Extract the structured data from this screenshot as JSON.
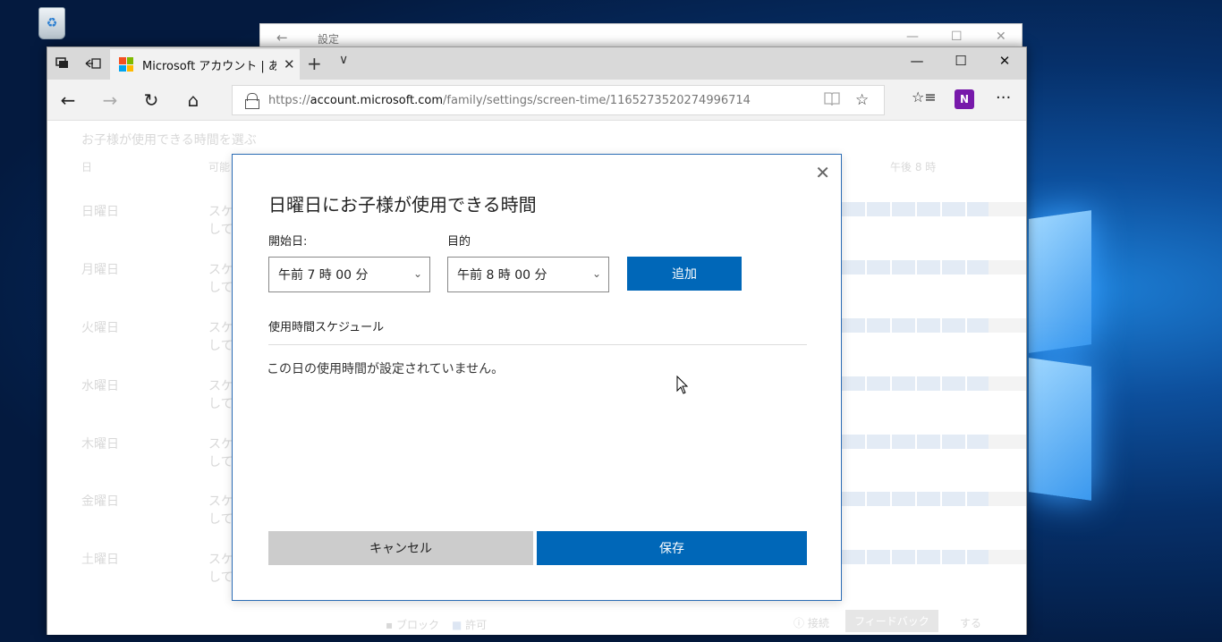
{
  "settings_window": {
    "title": "設定",
    "back_icon": "←",
    "minimize_icon": "—",
    "maximize_icon": "☐",
    "close_icon": "✕"
  },
  "browser": {
    "tab": {
      "title": "Microsoft アカウント | あな",
      "close_icon": "✕"
    },
    "new_tab_icon": "+",
    "tab_list_icon": "∨",
    "window_controls": {
      "minimize": "—",
      "maximize": "☐",
      "close": "✕"
    },
    "nav": {
      "back_icon": "←",
      "forward_icon": "→",
      "refresh_icon": "↻",
      "home_icon": "⌂"
    },
    "address": {
      "prefix": "https://",
      "host": "account.microsoft.com",
      "path": "/family/settings/screen-time/1165273520274996714"
    },
    "reading_view_icon": "📖",
    "favorite_icon": "☆",
    "favorites_hub_icon": "☆≡",
    "onenote_label": "N",
    "more_icon": "···",
    "colors": {
      "ms_red": "#f25022",
      "ms_green": "#7fba00",
      "ms_blue": "#00a4ef",
      "ms_yellow": "#ffb900"
    }
  },
  "page": {
    "heading": "お子様が使用できる時間を選ぶ",
    "col_day": "日",
    "col_allowed": "可能",
    "col_time": "午後 8 時",
    "days": [
      "日曜日",
      "月曜日",
      "火曜日",
      "水曜日",
      "木曜日",
      "金曜日",
      "土曜日"
    ],
    "row_text_1": "スケ",
    "row_text_2": "して",
    "legend_block": "ブロック",
    "legend_allow": "許可",
    "feedback": "フィードバック",
    "footer_left": "ⓘ 接続",
    "footer_right": "する"
  },
  "dialog": {
    "close_icon": "✕",
    "title": "日曜日にお子様が使用できる時間",
    "start_label": "開始日:",
    "end_label": "目的",
    "start_value": "午前 7 時 00 分",
    "end_value": "午前 8 時 00 分",
    "chevron_icon": "⌄",
    "add_button": "追加",
    "schedule_label": "使用時間スケジュール",
    "empty_message": "この日の使用時間が設定されていません。",
    "cancel_button": "キャンセル",
    "save_button": "保存",
    "accent_color": "#0067b8"
  }
}
